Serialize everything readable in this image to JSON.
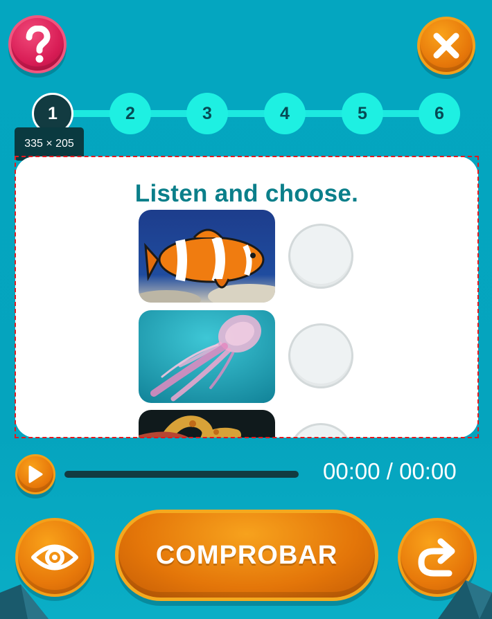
{
  "header": {
    "help_icon": "question-mark-icon",
    "close_icon": "close-x-icon"
  },
  "stepper": {
    "steps": [
      "1",
      "2",
      "3",
      "4",
      "5",
      "6"
    ],
    "active": "1"
  },
  "tooltip": {
    "text": "335 × 205"
  },
  "card": {
    "title": "Listen and choose.",
    "options": [
      {
        "image": "clownfish",
        "selected": false
      },
      {
        "image": "jellyfish",
        "selected": false
      },
      {
        "image": "seahorse",
        "selected": false
      }
    ]
  },
  "audio": {
    "play_icon": "play-icon",
    "time": "00:00 / 00:00",
    "progress": 0
  },
  "actions": {
    "eye_icon": "eye-icon",
    "check_label": "COMPROBAR",
    "redo_icon": "redo-arrow-icon"
  },
  "colors": {
    "background": "#04a6c0",
    "accent_orange": "#e7780a",
    "help_pink": "#d81c55",
    "step_cyan": "#1ef0e2",
    "step_active": "#123b41",
    "title_teal": "#0b7f8a"
  }
}
